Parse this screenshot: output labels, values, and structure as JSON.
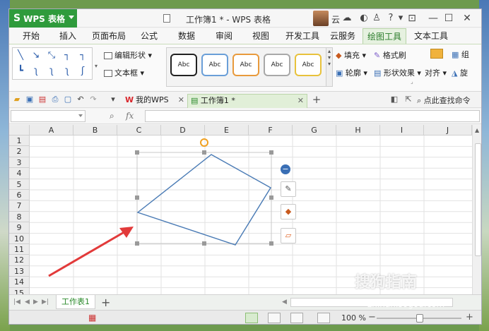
{
  "title_bar": {
    "app_name": "WPS 表格",
    "window_title": "工作簿1 * - WPS 表格",
    "cloud_label": "云",
    "help_label": "?"
  },
  "menu_tabs": [
    {
      "label": "开始"
    },
    {
      "label": "插入"
    },
    {
      "label": "页面布局"
    },
    {
      "label": "公式"
    },
    {
      "label": "数据"
    },
    {
      "label": "审阅"
    },
    {
      "label": "视图"
    },
    {
      "label": "开发工具"
    },
    {
      "label": "云服务"
    },
    {
      "label": "绘图工具",
      "active": true
    },
    {
      "label": "文本工具"
    }
  ],
  "ribbon": {
    "edit_shape": "编辑形状",
    "text_box": "文本框",
    "style_label": "Abc",
    "fill": "填充",
    "format_painter": "格式刷",
    "outline": "轮廓",
    "shape_effects": "形状效果",
    "align": "对齐",
    "group": "组",
    "rotate": "旋"
  },
  "quick_access": {
    "tab_my_wps": "我的WPS",
    "tab_workbook": "工作簿1 *",
    "search_command": "点此查找命令"
  },
  "formula_bar": {
    "fx": "fx",
    "name_box_value": "",
    "formula_value": ""
  },
  "sheet": {
    "columns": [
      "A",
      "B",
      "C",
      "D",
      "E",
      "F",
      "G",
      "H",
      "I",
      "J"
    ],
    "rows": [
      "1",
      "2",
      "3",
      "4",
      "5",
      "6",
      "7",
      "8",
      "9",
      "10",
      "11",
      "12",
      "13",
      "14",
      "15"
    ]
  },
  "sheet_tabs": {
    "active_sheet": "工作表1",
    "add": "+"
  },
  "status_bar": {
    "zoom": "100 %"
  },
  "watermark": {
    "brand": "搜狗指南",
    "url": "zhinan.sogou.com"
  },
  "colors": {
    "accent_green": "#2f9b3c",
    "shape_stroke": "#4a7bb5",
    "arrow_red": "#e23a3a"
  }
}
